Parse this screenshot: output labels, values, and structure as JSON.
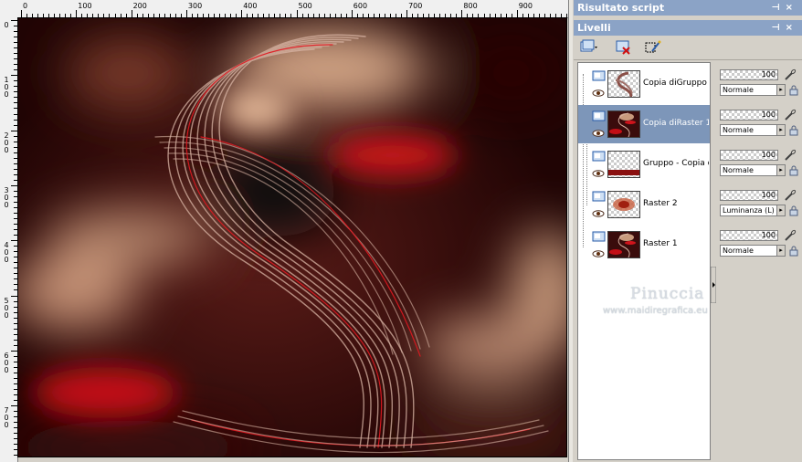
{
  "ruler": {
    "top_labels": [
      "0",
      "100",
      "200",
      "300",
      "400",
      "500",
      "600",
      "700",
      "800",
      "900"
    ],
    "left_labels": [
      "0",
      "1 0 0",
      "2 0 0",
      "3 0 0",
      "4 0 0",
      "5 0 0",
      "6 0 0",
      "7 0 0"
    ]
  },
  "canvas": {
    "name": "image-canvas",
    "colors": {
      "dark": "#2a0707",
      "red": "#c8101a",
      "peach": "#d8a884",
      "maroon": "#5a1414"
    }
  },
  "script_panel": {
    "title": "Risultato script"
  },
  "layers_panel": {
    "title": "Livelli",
    "toolbar": [
      {
        "icon": "new-layer-icon"
      },
      {
        "icon": "delete-layer-icon"
      },
      {
        "icon": "mask-selection-icon"
      }
    ],
    "layers": [
      {
        "name": "Copia diGruppo -",
        "thumb": "swirl",
        "opacity": "100",
        "blend": "Normale",
        "selected": false
      },
      {
        "name": "Copia diRaster 1",
        "thumb": "image",
        "opacity": "100",
        "blend": "Normale",
        "selected": true
      },
      {
        "name": "Gruppo - Copia d",
        "thumb": "red-strip",
        "opacity": "100",
        "blend": "Normale",
        "selected": false
      },
      {
        "name": "Raster 2",
        "thumb": "blur",
        "opacity": "100",
        "blend": "Luminanza (L)",
        "selected": false
      },
      {
        "name": "Raster 1",
        "thumb": "image",
        "opacity": "100",
        "blend": "Normale",
        "selected": false
      }
    ]
  },
  "watermark": {
    "name": "Pinuccia",
    "url": "www.maidiregrafica.eu"
  },
  "colors": {
    "panel_title_bg": "#8ba3c6",
    "selected_row_bg": "#7d96b9",
    "panel_bg": "#d4d0c8"
  }
}
